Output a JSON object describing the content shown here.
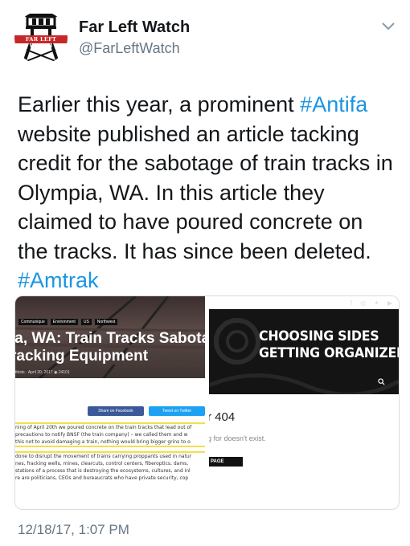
{
  "account": {
    "name": "Far Left Watch",
    "handle": "@FarLeftWatch",
    "avatar_text": "FAR LEFT WATCH",
    "avatar_color": "#c62828"
  },
  "tweet": {
    "segments": [
      {
        "text": "Earlier this year, a prominent ",
        "type": "text"
      },
      {
        "text": "#Antifa",
        "type": "hashtag"
      },
      {
        "text": " website published an article tacking credit for the sabotage of train tracks in Olympia, WA. In this article they claimed to have poured concrete on the tracks. It has since been deleted. ",
        "type": "text"
      },
      {
        "text": "#Amtrak",
        "type": "hashtag"
      }
    ],
    "timestamp": "12/18/17, 1:07 PM",
    "hashtag_color": "#1b95e0"
  },
  "card_left": {
    "breadcrumbs": [
      "Communique",
      "Environment",
      "US",
      "Northwest"
    ],
    "title_line1": "ia, WA: Train Tracks Sabota",
    "title_line2": "racking Equipment",
    "meta": "thists · April 20, 2017  ◉ 24101",
    "share_facebook": "Share on Facebook",
    "share_twitter": "Tweet on Twitter",
    "body_lines": [
      "ning of April 20th we poured concrete on the train tracks that lead out of",
      " precautions to notify BNSF (the train company) – we called them and w",
      " this not to avoid damaging a train, nothing would bring bigger grins to o",
      "",
      " done to disrupt the movement of trains carrying proppants used in natur",
      "nes, fracking wells, mines, clearcuts, control centers, fiberoptics, dams,",
      "stations of a process that is destroying the ecosystems, cultures, and inl",
      "re are politicians, CEOs and bureaucrats who have private security, cop"
    ]
  },
  "card_right": {
    "social_icons": [
      "f",
      "instagram-icon",
      "twitter-icon",
      "youtube-icon"
    ],
    "banner_line1": "CHOOSING SIDES",
    "banner_line2": "GETTING ORGANIZED",
    "error_title": "r 404",
    "error_subtitle": "g for doesn't exist.",
    "home_button": "PAGE"
  }
}
